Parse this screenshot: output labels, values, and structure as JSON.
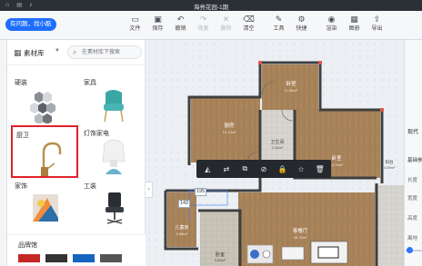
{
  "window": {
    "title": "海亮花园-1期",
    "icons": [
      "home-icon",
      "message-icon",
      "bell-icon"
    ]
  },
  "toolbar": {
    "help_label": "有问题，找小酷",
    "tools": [
      {
        "id": "file",
        "label": "文件",
        "icon": "file-icon",
        "glyph": "▭",
        "enabled": true
      },
      {
        "id": "save",
        "label": "保存",
        "icon": "save-icon",
        "glyph": "▣",
        "enabled": true
      },
      {
        "id": "undo",
        "label": "撤销",
        "icon": "undo-icon",
        "glyph": "↶",
        "enabled": true
      },
      {
        "id": "redo",
        "label": "恢复",
        "icon": "redo-icon",
        "glyph": "↷",
        "enabled": false
      },
      {
        "id": "delete",
        "label": "删除",
        "icon": "delete-icon",
        "glyph": "✕",
        "enabled": false
      },
      {
        "id": "clear",
        "label": "清空",
        "icon": "clear-icon",
        "glyph": "⌫",
        "enabled": true
      },
      {
        "id": "tools",
        "label": "工具",
        "icon": "wrench-icon",
        "glyph": "✎",
        "enabled": true
      },
      {
        "id": "shortcuts",
        "label": "快捷",
        "icon": "shortcut-icon",
        "glyph": "⚙",
        "enabled": true
      },
      {
        "id": "render",
        "label": "渲染",
        "icon": "camera-icon",
        "glyph": "◉",
        "enabled": true
      },
      {
        "id": "drawings",
        "label": "图册",
        "icon": "album-icon",
        "glyph": "▦",
        "enabled": true
      },
      {
        "id": "export",
        "label": "导出",
        "icon": "export-icon",
        "glyph": "⇪",
        "enabled": true
      }
    ]
  },
  "panel": {
    "title": "素材库",
    "search_placeholder": "在素材库下搜索",
    "categories": [
      {
        "id": "hard",
        "label": "硬装",
        "selected": false
      },
      {
        "id": "furniture",
        "label": "家具",
        "selected": false
      },
      {
        "id": "kitchen-bath",
        "label": "厨卫",
        "selected": true
      },
      {
        "id": "lighting",
        "label": "灯饰家电",
        "selected": false
      },
      {
        "id": "decor",
        "label": "家饰",
        "selected": false
      },
      {
        "id": "tooling",
        "label": "工装",
        "selected": false
      }
    ],
    "brand_label": "品牌馆"
  },
  "floorplan": {
    "rooms": [
      {
        "name": "卧室",
        "area": "11.08m²"
      },
      {
        "name": "卧室",
        "area": "14.76m²"
      },
      {
        "name": "厨房",
        "area": "10.13m²"
      },
      {
        "name": "卫生间",
        "area": "2.35m²"
      },
      {
        "name": "客餐厅",
        "area": "38.72m²"
      },
      {
        "name": "卧室",
        "area": "3.55m²"
      },
      {
        "name": "阳台",
        "area": "3.09m²"
      },
      {
        "name": "儿童房",
        "area": "9.58m²"
      }
    ],
    "dimensions": [
      "195",
      "142"
    ]
  },
  "object_toolbar": {
    "icons": [
      {
        "name": "mirror-icon",
        "glyph": "◭"
      },
      {
        "name": "swap-icon",
        "glyph": "⇄"
      },
      {
        "name": "replace-icon",
        "glyph": "⧉"
      },
      {
        "name": "hide-icon",
        "glyph": "⊘"
      },
      {
        "name": "lock-icon",
        "glyph": "🔒"
      },
      {
        "name": "favorite-icon",
        "glyph": "☆"
      },
      {
        "name": "trash-icon",
        "glyph": "🗑"
      }
    ]
  },
  "right_panel": {
    "header": "现代",
    "section": "基础参",
    "fields": [
      "长度",
      "宽度",
      "高度",
      "离地"
    ]
  },
  "colors": {
    "titlebar": "#2b2f36",
    "accent": "#1e6fff",
    "selection": "#e0212b",
    "wood": "#a8835a",
    "wall": "#4a4a4a"
  }
}
